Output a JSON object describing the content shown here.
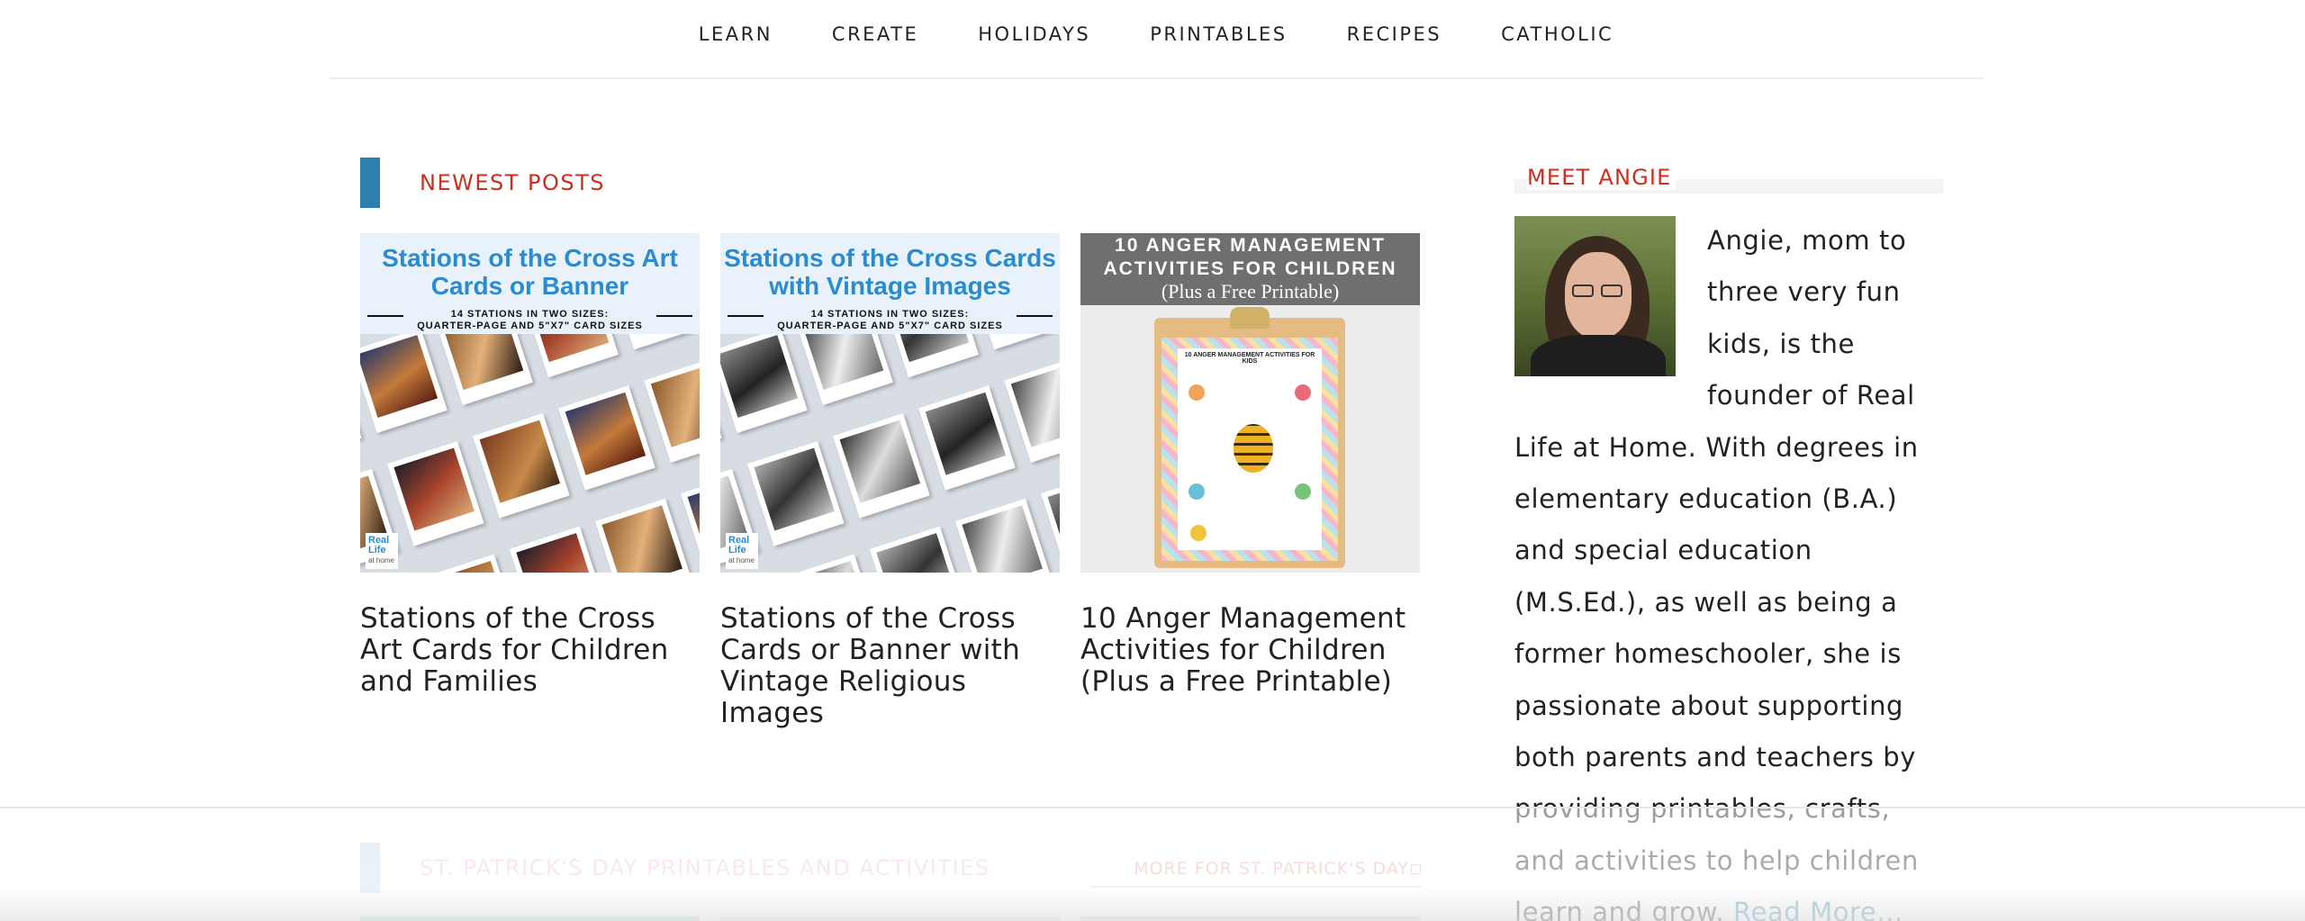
{
  "nav": {
    "items": [
      {
        "label": "LEARN"
      },
      {
        "label": "CREATE"
      },
      {
        "label": "HOLIDAYS"
      },
      {
        "label": "PRINTABLES"
      },
      {
        "label": "RECIPES"
      },
      {
        "label": "CATHOLIC"
      }
    ]
  },
  "newest": {
    "heading": "NEWEST POSTS",
    "posts": [
      {
        "title": "Stations of the Cross Art Cards for Children and Families",
        "thumb_heading": "Stations of the Cross Art Cards or Banner",
        "thumb_sub_1": "14 STATIONS IN TWO SIZES:",
        "thumb_sub_2": "QUARTER-PAGE AND 5\"X7\" CARD SIZES",
        "logo_1": "Real",
        "logo_2": "Life",
        "logo_3": "at home"
      },
      {
        "title": "Stations of the Cross Cards or Banner with Vintage Religious Images",
        "thumb_heading": "Stations of the Cross Cards with Vintage Images",
        "thumb_sub_1": "14 STATIONS IN TWO SIZES:",
        "thumb_sub_2": "QUARTER-PAGE AND 5\"X7\" CARD SIZES",
        "logo_1": "Real",
        "logo_2": "Life",
        "logo_3": "at home"
      },
      {
        "title": "10 Anger Management Activities for Children (Plus a Free Printable)",
        "thumb_heading_1": "10 ANGER MANAGEMENT",
        "thumb_heading_2": "ACTIVITIES FOR CHILDREN",
        "thumb_sub": "(Plus a Free Printable)",
        "sheet_title": "10 ANGER MANAGEMENT ACTIVITIES FOR KIDS"
      }
    ]
  },
  "sidebar": {
    "heading": "MEET ANGIE",
    "bio": "Angie, mom to three very fun kids, is the founder of Real Life at Home.  With degrees in elementary education (B.A.) and special education (M.S.Ed.), as well as being a former homeschooler, she is passionate about supporting both parents and teachers by providing printables, crafts, and activities to help children learn and grow.",
    "read_more": "Read More..."
  },
  "stpatricks": {
    "heading": "ST. PATRICK'S DAY PRINTABLES AND ACTIVITIES",
    "more_link": "MORE FOR ST. PATRICK'S DAY"
  },
  "colors": {
    "accent_red": "#c9301f",
    "accent_blue": "#2e7fae",
    "text": "#222222"
  }
}
